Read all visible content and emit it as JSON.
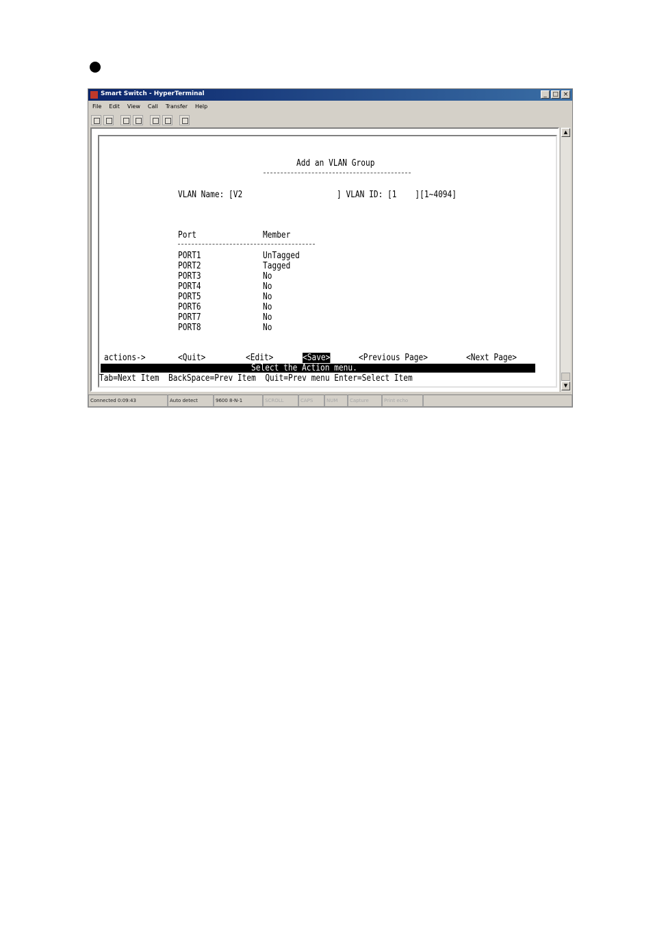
{
  "window": {
    "title": "Smart Switch - HyperTerminal",
    "controls": [
      "_",
      "□",
      "×"
    ]
  },
  "menubar": [
    "File",
    "Edit",
    "View",
    "Call",
    "Transfer",
    "Help"
  ],
  "toolbar": [
    "new-icon",
    "open-icon",
    "connect-icon",
    "disconnect-icon",
    "send-icon",
    "receive-icon",
    "properties-icon"
  ],
  "screen": {
    "title": "Add an VLAN Group",
    "vlan_name_label": "VLAN Name: [V2",
    "vlan_id_label": "] VLAN ID: [1    ][1~4094]",
    "headers": {
      "port": "Port",
      "member": "Member"
    },
    "rows": [
      {
        "port": "PORT1",
        "member": "UnTagged"
      },
      {
        "port": "PORT2",
        "member": "Tagged"
      },
      {
        "port": "PORT3",
        "member": "No"
      },
      {
        "port": "PORT4",
        "member": "No"
      },
      {
        "port": "PORT5",
        "member": "No"
      },
      {
        "port": "PORT6",
        "member": "No"
      },
      {
        "port": "PORT7",
        "member": "No"
      },
      {
        "port": "PORT8",
        "member": "No"
      }
    ],
    "actions_label": "actions->",
    "actions": [
      "<Quit>",
      "<Edit>",
      "<Save>",
      "<Previous Page>",
      "<Next Page>"
    ],
    "selected_action": "<Save>",
    "hint": "Select the Action menu.",
    "help_line": "Tab=Next Item  BackSpace=Prev Item  Quit=Prev menu Enter=Select Item"
  },
  "statusbar": [
    "Connected 0:09:43",
    "Auto detect",
    "9600 8-N-1",
    "SCROLL",
    "CAPS",
    "NUM",
    "Capture",
    "Print echo"
  ]
}
